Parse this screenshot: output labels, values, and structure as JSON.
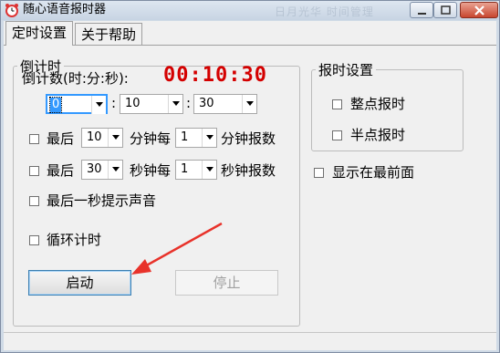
{
  "window": {
    "title": "随心语音报时器",
    "background_hint": "日月光华 时间管理"
  },
  "tabs": [
    {
      "label": "定时设置",
      "active": true
    },
    {
      "label": "关于帮助",
      "active": false
    }
  ],
  "countdown": {
    "legend": "倒计时",
    "label": "倒计数(时:分:秒):",
    "display": "00:10:30",
    "hours": "0",
    "minutes": "10",
    "seconds": "30",
    "sep": ":"
  },
  "options": {
    "last_min": {
      "checked": false,
      "prefix": "最后",
      "value": "10",
      "mid": "分钟每",
      "value2": "1",
      "suffix": "分钟报数"
    },
    "last_sec": {
      "checked": false,
      "prefix": "最后",
      "value": "30",
      "mid": "秒钟每",
      "value2": "1",
      "suffix": "秒钟报数"
    },
    "last_second_sound": {
      "checked": false,
      "label": "最后一秒提示声音"
    },
    "loop": {
      "checked": false,
      "label": "循环计时"
    }
  },
  "buttons": {
    "start": "启动",
    "stop": "停止"
  },
  "announce": {
    "legend": "报时设置",
    "on_hour": {
      "checked": false,
      "label": "整点报时"
    },
    "half_hour": {
      "checked": false,
      "label": "半点报时"
    }
  },
  "topmost": {
    "checked": false,
    "label": "显示在最前面"
  },
  "colors": {
    "accent": "#d40000",
    "selection": "#3399ff",
    "annotation_arrow": "#e8322a"
  }
}
